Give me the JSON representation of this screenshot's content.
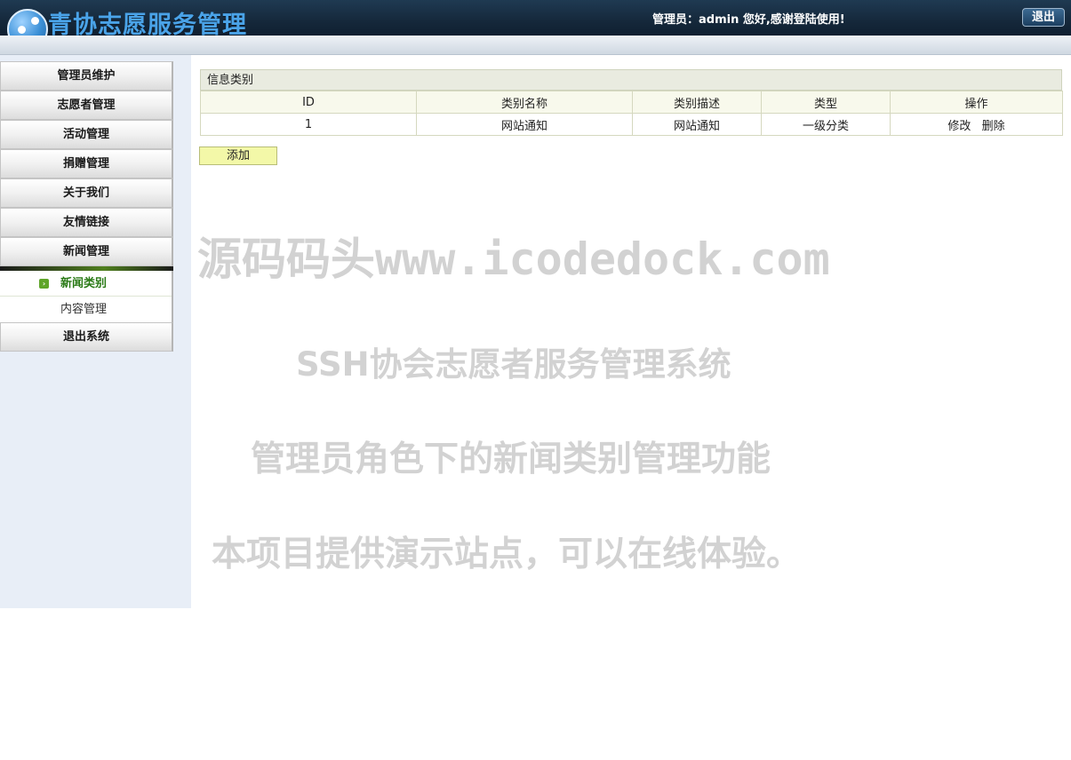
{
  "header": {
    "app_title": "青协志愿服务管理",
    "welcome": "管理员：admin 您好,感谢登陆使用!",
    "logout_label": "退出"
  },
  "sidebar": {
    "items_top": [
      {
        "label": "管理员维护"
      },
      {
        "label": "志愿者管理"
      },
      {
        "label": "活动管理"
      },
      {
        "label": "捐赠管理"
      },
      {
        "label": "关于我们"
      },
      {
        "label": "友情链接"
      },
      {
        "label": "新闻管理"
      }
    ],
    "sub_items": [
      {
        "label": "新闻类别",
        "active": true
      },
      {
        "label": "内容管理",
        "active": false
      }
    ],
    "items_bottom": [
      {
        "label": "退出系统"
      }
    ]
  },
  "main": {
    "panel_title": "信息类别",
    "columns": [
      "ID",
      "类别名称",
      "类别描述",
      "类型",
      "操作"
    ],
    "rows": [
      {
        "id": "1",
        "name": "网站通知",
        "description": "网站通知",
        "type": "一级分类",
        "edit_label": "修改",
        "delete_label": "删除"
      }
    ],
    "add_label": "添加"
  },
  "watermark": {
    "line1": "源码码头www.icodedock.com",
    "line2": "SSH协会志愿者服务管理系统",
    "line3": "管理员角色下的新闻类别管理功能",
    "line4": "本项目提供演示站点，可以在线体验。"
  },
  "colors": {
    "header_bg": "#15283b",
    "title_blue": "#4aa3e8",
    "active_green": "#2a7a16",
    "add_button_bg": "#f3f8a8",
    "sidebar_bg": "#e8eef7"
  }
}
